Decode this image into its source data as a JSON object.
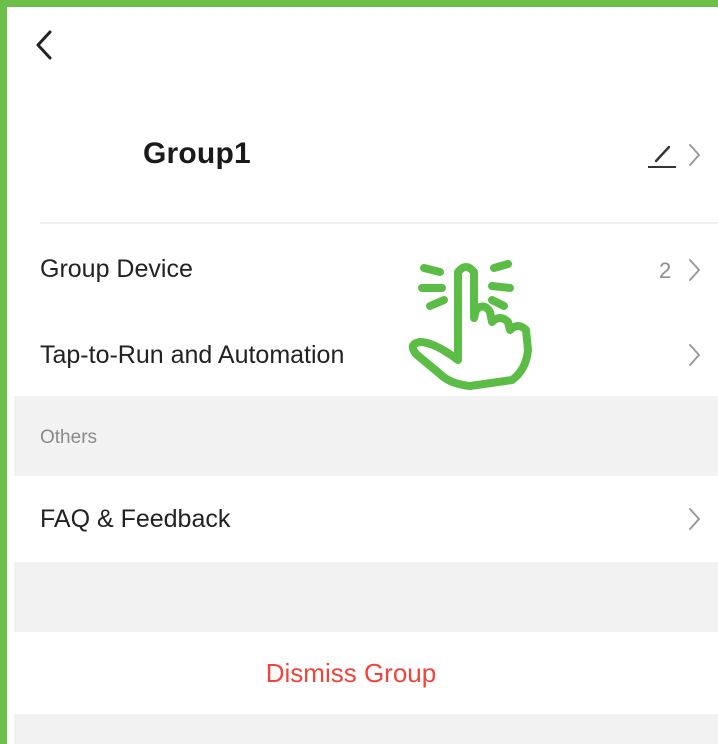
{
  "header": {
    "back_icon": "chevron-left-icon"
  },
  "group": {
    "name": "Group1",
    "edit_icon": "pencil-icon",
    "chevron_icon": "chevron-right-icon"
  },
  "rows": [
    {
      "label": "Group Device",
      "value": "2",
      "chevron_icon": "chevron-right-icon"
    },
    {
      "label": "Tap-to-Run and Automation",
      "chevron_icon": "chevron-right-icon"
    }
  ],
  "others_section": {
    "title": "Others",
    "rows": [
      {
        "label": "FAQ & Feedback",
        "chevron_icon": "chevron-right-icon"
      }
    ]
  },
  "dismiss": {
    "label": "Dismiss Group"
  },
  "overlay": {
    "icon": "tap-hand-icon"
  },
  "colors": {
    "frame": "#6cc04a",
    "danger": "#f0443a",
    "section_bg": "#f2f2f2",
    "secondary_text": "#8a8a8a"
  }
}
